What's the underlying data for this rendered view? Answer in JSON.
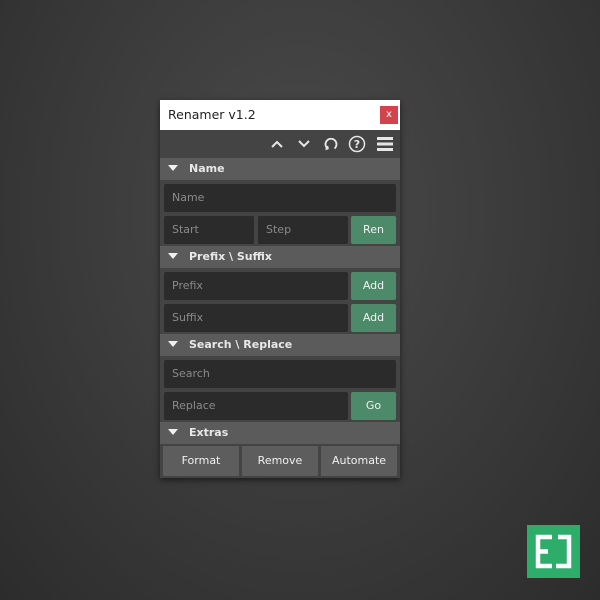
{
  "window": {
    "title": "Renamer v1.2",
    "close_label": "x"
  },
  "toolbar": {
    "icons": [
      "chevron-up-icon",
      "chevron-down-icon",
      "refresh-icon",
      "help-icon",
      "menu-icon"
    ]
  },
  "sections": {
    "name": {
      "label": "Name",
      "name_placeholder": "Name",
      "start_placeholder": "Start",
      "step_placeholder": "Step",
      "rename_label": "Ren"
    },
    "prefix_suffix": {
      "label": "Prefix \\ Suffix",
      "prefix_placeholder": "Prefix",
      "suffix_placeholder": "Suffix",
      "add_prefix_label": "Add",
      "add_suffix_label": "Add"
    },
    "search_replace": {
      "label": "Search \\ Replace",
      "search_placeholder": "Search",
      "replace_placeholder": "Replace",
      "go_label": "Go"
    },
    "extras": {
      "label": "Extras",
      "format_label": "Format",
      "remove_label": "Remove",
      "automate_label": "Automate"
    }
  },
  "colors": {
    "accent_green": "#4d8a69",
    "close_red": "#d2434c",
    "logo_green": "#2dac6a"
  }
}
